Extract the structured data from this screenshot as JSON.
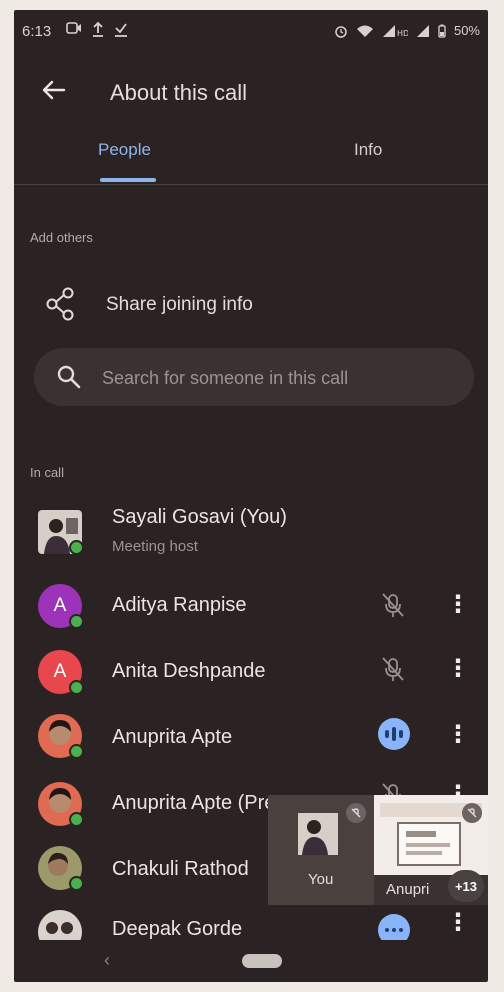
{
  "status_bar": {
    "time": "6:13",
    "left_icons": [
      "screen-record-icon",
      "upload-icon",
      "download-done-icon"
    ],
    "right_icons": [
      "alarm-icon",
      "wifi-icon",
      "signal-hd-icon",
      "signal-icon",
      "battery-icon"
    ],
    "battery": "50%"
  },
  "app_bar": {
    "back_icon": "arrow-left-icon",
    "title": "About this call"
  },
  "tabs": [
    {
      "label": "People",
      "selected": true
    },
    {
      "label": "Info",
      "selected": false
    }
  ],
  "add_others": {
    "section_label": "Add others",
    "share_label": "Share joining info"
  },
  "search": {
    "placeholder": "Search for someone in this call"
  },
  "in_call": {
    "section_label": "In call",
    "participants": [
      {
        "name": "Sayali Gosavi (You)",
        "subtitle": "Meeting host",
        "avatar": "photo"
      },
      {
        "name": "Aditya Ranpise",
        "avatar_letter": "A",
        "avatar_color": "#9c33b8",
        "mic": "muted"
      },
      {
        "name": "Anita Deshpande",
        "avatar_letter": "A",
        "avatar_color": "#e8474d",
        "mic": "muted"
      },
      {
        "name": "Anuprita Apte",
        "avatar": "photo",
        "mic": "speaking"
      },
      {
        "name": "Anuprita Apte (Prese",
        "avatar": "photo",
        "mic": "muted"
      },
      {
        "name": "Chakuli Rathod",
        "avatar": "photo"
      },
      {
        "name": "Deepak Gorde",
        "avatar": "photo",
        "mic": "speaking"
      }
    ]
  },
  "video_tiles": {
    "self_label": "You",
    "other_label": "Anupri",
    "overflow_count": "+13"
  },
  "colors": {
    "background": "#2b2323",
    "accent": "#8fb6ea",
    "presence": "#4caf50"
  }
}
